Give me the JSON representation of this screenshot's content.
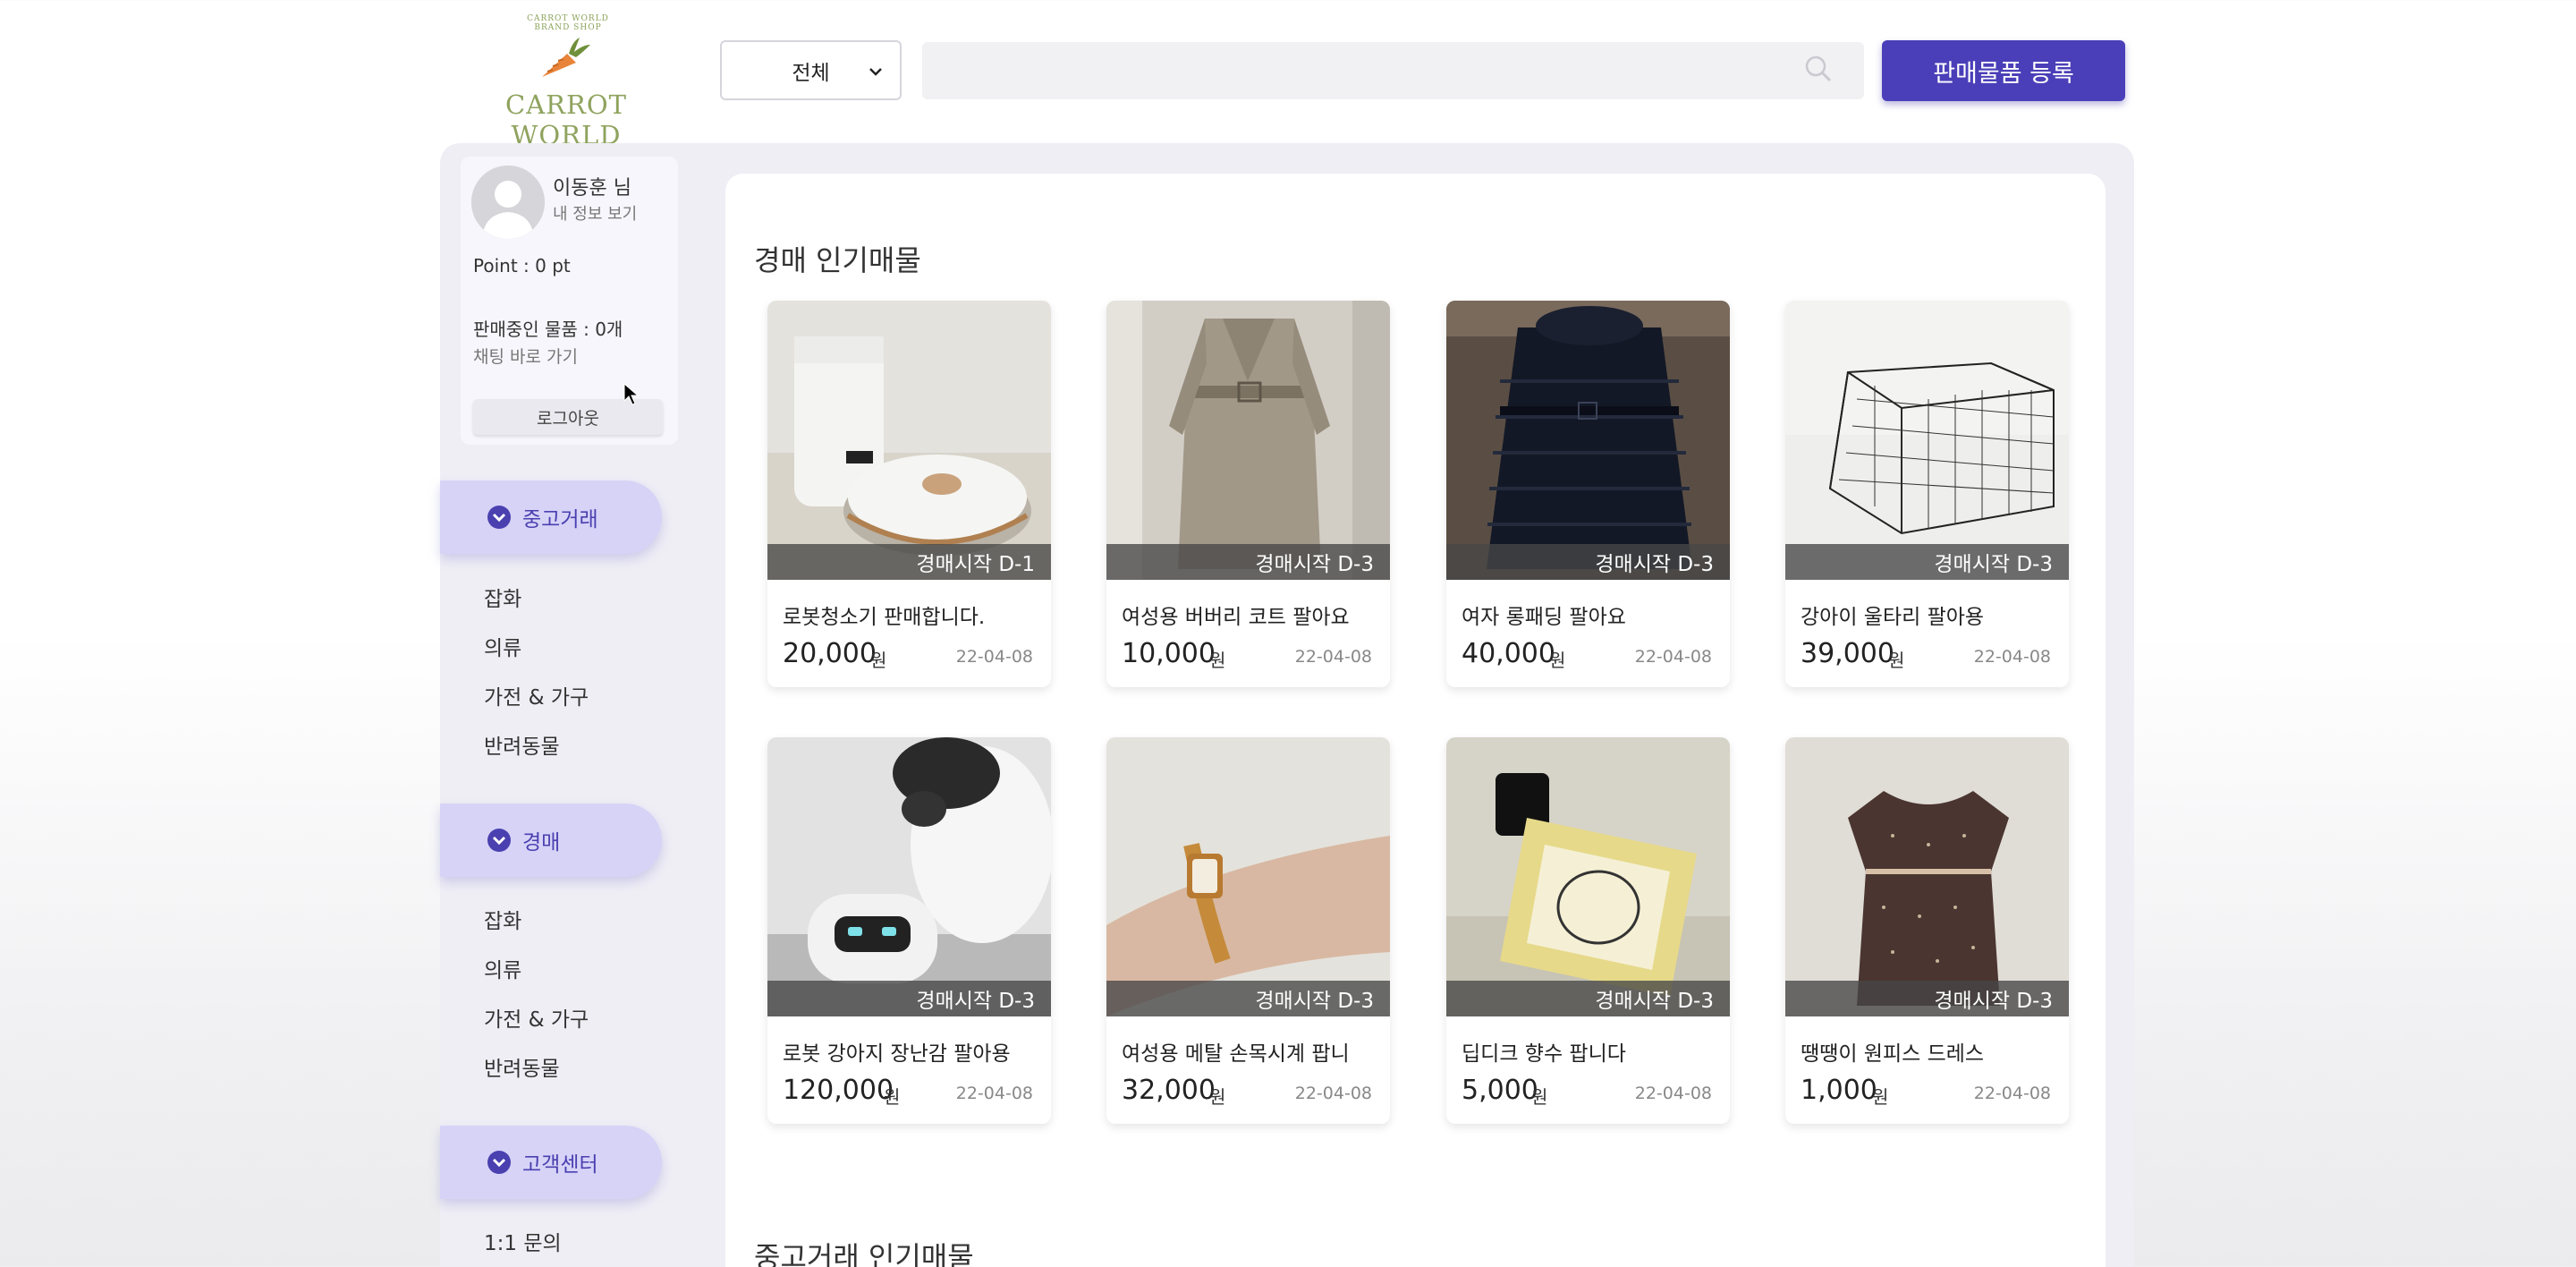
{
  "logo": {
    "arc_text": "CARROT WORLD BRAND SHOP",
    "name": "CARROT WORLD"
  },
  "header": {
    "category_selected": "전체",
    "search_placeholder": "",
    "register_label": "판매물품 등록"
  },
  "profile": {
    "name": "이동훈 님",
    "info_link": "내 정보 보기",
    "point": "Point : 0 pt",
    "selling": "판매중인 물품 : 0개",
    "chat_link": "채팅 바로 가기",
    "logout": "로그아웃"
  },
  "menu": {
    "used": {
      "label": "중고거래",
      "items": [
        "잡화",
        "의류",
        "가전 & 가구",
        "반려동물"
      ]
    },
    "auction": {
      "label": "경매",
      "items": [
        "잡화",
        "의류",
        "가전 & 가구",
        "반려동물"
      ]
    },
    "support": {
      "label": "고객센터",
      "items": [
        "1:1 문의"
      ]
    }
  },
  "sections": {
    "auction_popular": "경매 인기매물",
    "used_popular": "중고거래 인기매물"
  },
  "products": [
    {
      "title": "로봇청소기 판매합니다.",
      "price": "20,000",
      "unit": "원",
      "date": "22-04-08",
      "badge": "경매시작 D-1",
      "image": "robot-vacuum"
    },
    {
      "title": "여성용 버버리 코트 팔아요",
      "price": "10,000",
      "unit": "원",
      "date": "22-04-08",
      "badge": "경매시작 D-3",
      "image": "trench-coat"
    },
    {
      "title": "여자 롱패딩 팔아요",
      "price": "40,000",
      "unit": "원",
      "date": "22-04-08",
      "badge": "경매시작 D-3",
      "image": "padded-coat"
    },
    {
      "title": "강아이 울타리 팔아용",
      "price": "39,000",
      "unit": "원",
      "date": "22-04-08",
      "badge": "경매시작 D-3",
      "image": "pet-fence"
    },
    {
      "title": "로봇 강아지 장난감 팔아용",
      "price": "120,000",
      "unit": "원",
      "date": "22-04-08",
      "badge": "경매시작 D-3",
      "image": "robot-toy"
    },
    {
      "title": "여성용 메탈 손목시계 팝니",
      "price": "32,000",
      "unit": "원",
      "date": "22-04-08",
      "badge": "경매시작 D-3",
      "image": "wrist-watch"
    },
    {
      "title": "딥디크 향수 팝니다",
      "price": "5,000",
      "unit": "원",
      "date": "22-04-08",
      "badge": "경매시작 D-3",
      "image": "perfume"
    },
    {
      "title": "땡땡이 원피스 드레스",
      "price": "1,000",
      "unit": "원",
      "date": "22-04-08",
      "badge": "경매시작 D-3",
      "image": "dress"
    }
  ],
  "colors": {
    "accent": "#4a3fb8",
    "menu_pill": "#d6d3f7",
    "frame": "#efeef5"
  }
}
